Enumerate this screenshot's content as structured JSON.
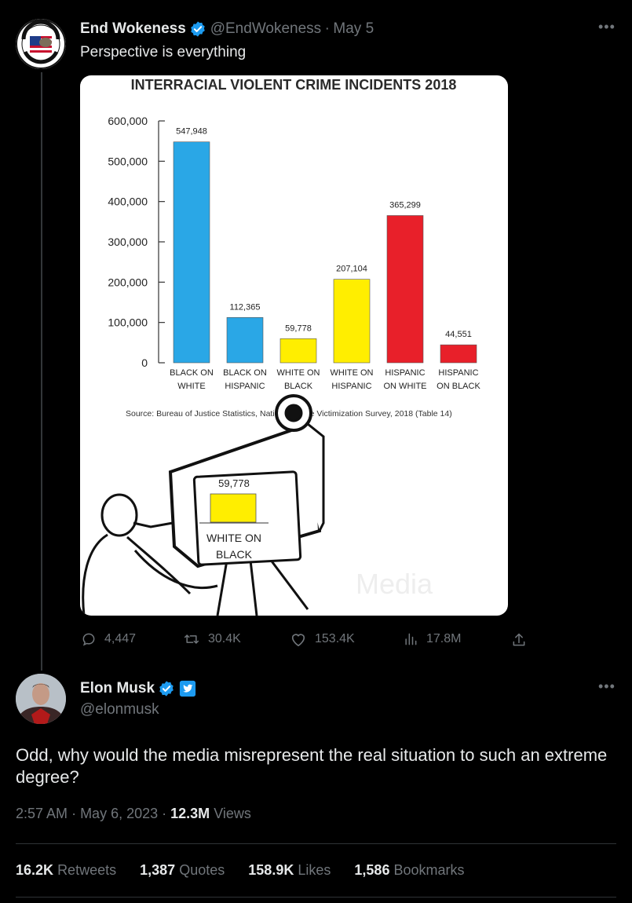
{
  "tweet1": {
    "author_name": "End Wokeness",
    "handle": "@EndWokeness",
    "date": "May 5",
    "text": "Perspective is everything",
    "avatar_icon": "i-support-former-twitter-logo",
    "avatar_text": "I SUPPORT THE FORMER TWITTER",
    "actions": {
      "replies": "4,447",
      "retweets": "30.4K",
      "likes": "153.4K",
      "views": "17.8M"
    }
  },
  "chart_data": {
    "type": "bar",
    "title": "INTERRACIAL VIOLENT CRIME INCIDENTS 2018",
    "categories": [
      "BLACK ON WHITE",
      "BLACK ON HISPANIC",
      "WHITE ON BLACK",
      "WHITE ON HISPANIC",
      "HISPANIC ON WHITE",
      "HISPANIC ON BLACK"
    ],
    "category_lines": [
      [
        "BLACK ON",
        "WHITE"
      ],
      [
        "BLACK ON",
        "HISPANIC"
      ],
      [
        "WHITE ON",
        "BLACK"
      ],
      [
        "WHITE ON",
        "HISPANIC"
      ],
      [
        "HISPANIC",
        "ON WHITE"
      ],
      [
        "HISPANIC",
        "ON BLACK"
      ]
    ],
    "values": [
      547948,
      112365,
      59778,
      207104,
      365299,
      44551
    ],
    "data_labels": [
      "547,948",
      "112,365",
      "59,778",
      "207,104",
      "365,299",
      "44,551"
    ],
    "colors": [
      "#2aa7e6",
      "#2aa7e6",
      "#ffee00",
      "#ffee00",
      "#e8202a",
      "#e8202a"
    ],
    "ylim": [
      0,
      600000
    ],
    "yticks": [
      "0",
      "100,000",
      "200,000",
      "300,000",
      "400,000",
      "500,000",
      "600,000"
    ],
    "ytick_values": [
      0,
      100000,
      200000,
      300000,
      400000,
      500000,
      600000
    ],
    "source": "Source: Bureau of Justice Statistics, National Crime Victimization Survey, 2018 (Table 14)",
    "inset_value": "59,778",
    "inset_label_lines": [
      "WHITE ON",
      "BLACK"
    ],
    "inset_color": "#ffee00",
    "watermark": "Media",
    "grid": false,
    "legend": "none"
  },
  "tweet2": {
    "author_name": "Elon Musk",
    "handle": "@elonmusk",
    "text": "Odd, why would the media misrepresent the real situation to such an extreme degree?",
    "time": "2:57 AM",
    "date": "May 6, 2023",
    "views_count": "12.3M",
    "views_label": "Views",
    "stats": {
      "retweets_count": "16.2K",
      "retweets_label": "Retweets",
      "quotes_count": "1,387",
      "quotes_label": "Quotes",
      "likes_count": "158.9K",
      "likes_label": "Likes",
      "bookmarks_count": "1,586",
      "bookmarks_label": "Bookmarks"
    }
  },
  "colors": {
    "background": "#000000",
    "text_primary": "#e7e9ea",
    "text_secondary": "#71767b",
    "verified": "#1d9bf0",
    "divider": "#2f3336"
  }
}
